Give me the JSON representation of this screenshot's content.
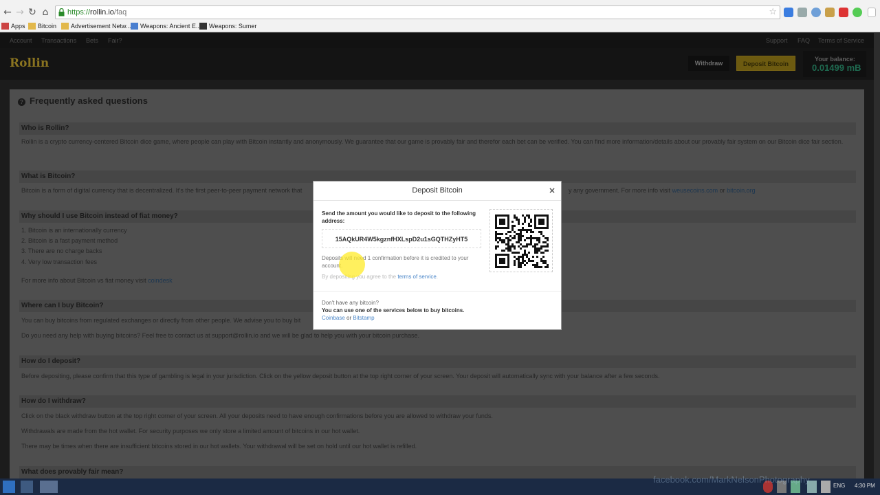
{
  "browser": {
    "url_scheme": "https://",
    "url_host": "rollin.io",
    "url_path": "/faq",
    "bookmarks": [
      "Apps",
      "Bitcoin",
      "Advertisement Netw...",
      "Weapons: Ancient E...",
      "Weapons: Sumer"
    ]
  },
  "site": {
    "topnav_left": [
      "Account",
      "Transactions",
      "Bets",
      "Fair?"
    ],
    "topnav_right": [
      "Support",
      "FAQ",
      "Terms of Service"
    ],
    "logo": "Rollin",
    "withdraw_label": "Withdraw",
    "deposit_label": "Deposit Bitcoin",
    "balance_label": "Your balance:",
    "balance_value": "0.01499 mB"
  },
  "faq": {
    "title": "Frequently asked questions",
    "who_q": "Who is Rollin?",
    "who_a": "Rollin is a crypto currency-centered Bitcoin dice game, where people can play with Bitcoin instantly and anonymously. We guarantee that our game is provably fair and therefor each bet can be verified. You can find more information/details about our provably fair system on our Bitcoin dice fair section.",
    "what_q": "What is Bitcoin?",
    "what_a": "Bitcoin is a form of digital currency that is decentralized. It's the first peer-to-peer payment network that",
    "what_a_tail": "y any government. For more info visit",
    "what_link1": "weusecoins.com",
    "what_or": "or",
    "what_link2": "bitcoin.org",
    "why_q": "Why should I use Bitcoin instead of fiat money?",
    "why_items": [
      "1.  Bitcoin is an internationally currency",
      "2.  Bitcoin is a fast payment method",
      "3.  There are no charge backs",
      "4.  Very low transaction fees"
    ],
    "why_more": "For more info about Bitcoin vs fiat money visit",
    "why_link": "coindesk",
    "where_q": "Where can I buy Bitcoin?",
    "where_a1": "You can buy bitcoins from regulated exchanges or directly from other people. We advise you to buy bit",
    "where_a2": "Do you need any help with buying bitcoins? Feel free to contact us at support@rollin.io and we will be glad to help you with your bitcoin purchase.",
    "dep_q": "How do I deposit?",
    "dep_a": "Before depositing, please confirm that this type of gambling is legal in your jurisdiction. Click on the yellow deposit button at the top right corner of your screen. Your deposit will automatically sync with your balance after a few seconds.",
    "wd_q": "How do I withdraw?",
    "wd_a1": "Click on the black withdraw button at the top right corner of your screen. All your deposits need to have enough confirmations before you are allowed to withdraw your funds.",
    "wd_a2": "Withdrawals are made from the hot wallet. For security purposes we only store a limited amount of bitcoins in our hot wallet.",
    "wd_a3": "There may be times when there are insufficient bitcoins stored in our hot wallets. Your withdrawal will be set on hold until our hot wallet is refilled.",
    "fair_q": "What does provably fair mean?"
  },
  "modal": {
    "title": "Deposit Bitcoin",
    "close": "×",
    "instruction": "Send the amount you would like to deposit to the following address:",
    "address": "15AQkUR4W5kgznfHXLspD2u1sGQTHZyHT5",
    "note": "Deposits will need 1 confirmation before it is credited to your account.",
    "terms_prefix": "By depositing you agree to the",
    "terms_link": "terms of service",
    "terms_suffix": ".",
    "no_btc": "Don't have any bitcoin?",
    "use_services": "You can use one of the services below to buy bitcoins.",
    "service1": "Coinbase",
    "or": "or",
    "service2": "Bitstamp"
  },
  "taskbar": {
    "lang": "ENG",
    "time": "4:30 PM"
  },
  "watermark": "facebook.com/MarkNelsonPhotography"
}
